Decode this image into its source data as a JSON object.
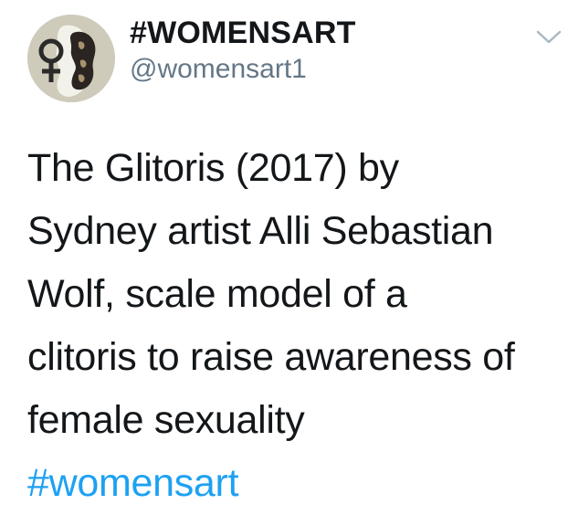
{
  "tweet": {
    "author": {
      "display_name": "#WOMENSART",
      "handle": "@womensart1",
      "avatar_icon": "venus-symbol-avatar"
    },
    "menu_icon": "chevron-down-icon",
    "text_lines": [
      "The Glitoris (2017) by",
      "Sydney artist Alli Sebastian",
      "Wolf, scale model of a",
      "clitoris to raise awareness of",
      "female sexuality"
    ],
    "hashtag": "#womensart"
  },
  "colors": {
    "text": "#14171a",
    "handle": "#657786",
    "link": "#1da1f2",
    "caret": "#aab8c2"
  }
}
